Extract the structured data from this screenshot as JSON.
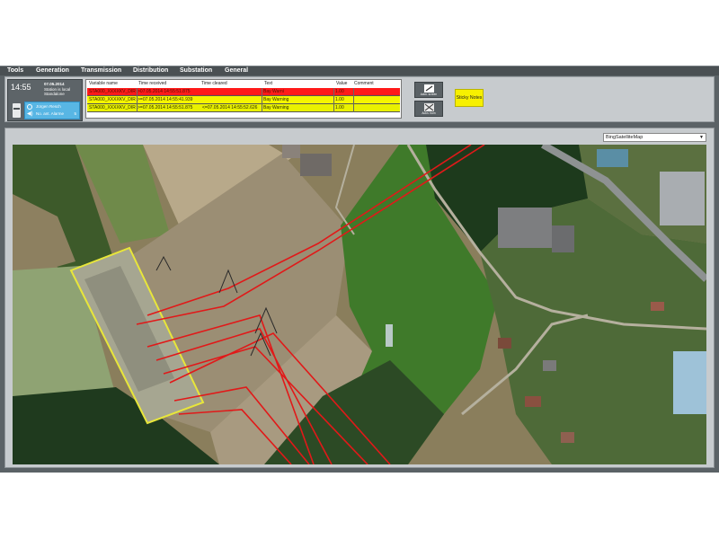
{
  "menu": [
    {
      "label": "Tools"
    },
    {
      "label": "Generation"
    },
    {
      "label": "Transmission"
    },
    {
      "label": "Distribution"
    },
    {
      "label": "Substation"
    },
    {
      "label": "General"
    }
  ],
  "clock": {
    "time": "14:55",
    "date": "07.05.2014",
    "line1": "Station is local",
    "line2": "Standalone"
  },
  "user": {
    "name": "Jürgen Resch",
    "ack_label": "No. ant. Alarme",
    "ack_count": "5"
  },
  "alarm_table": {
    "columns": [
      "Variable name",
      "Time received",
      "Time cleared",
      "Text",
      "Value",
      "Comment"
    ],
    "rows": [
      {
        "variable": "STA000_XXXXKV_DIR",
        "received": ">07.05.2014 14:55:51.875",
        "cleared": "",
        "text": "Bay Warni",
        "value": "1.00",
        "comment": "",
        "bg": "#ff1a1a",
        "fg": "#4a1000"
      },
      {
        "variable": "STA000_XXXXKV_DIR",
        "received": ">=07.05.2014 14:55:41.939",
        "cleared": "",
        "text": "Bay Warning",
        "value": "1.00",
        "comment": "",
        "bg": "#f5f500",
        "fg": "#2a2a00"
      },
      {
        "variable": "STA000_XXXXKV_DIR",
        "received": ">=07.05.2014 14:55:51.875",
        "cleared": "<=07.05.2014 14:55:52.626",
        "text": "Bay Warning",
        "value": "1.00",
        "comment": "",
        "bg": "#e9f100",
        "fg": "#2a2a00"
      }
    ]
  },
  "buttons": {
    "ack_screen": "Ackn. screen",
    "ack_horn": "Ackn. horn",
    "sticky_notes": "Sticky Notes"
  },
  "map": {
    "selected_layer": "BingSatelliteMap"
  },
  "colors": {
    "line_color": "#e11919",
    "station_outline": "#e8e63a",
    "accent_blue": "#58b6e4"
  },
  "icons": {
    "edit": "pencil-icon",
    "horn": "horn-cross-icon",
    "user": "user-icon",
    "speaker": "speaker-icon",
    "device": "device-icon",
    "dropdown": "chevron-down-icon"
  }
}
